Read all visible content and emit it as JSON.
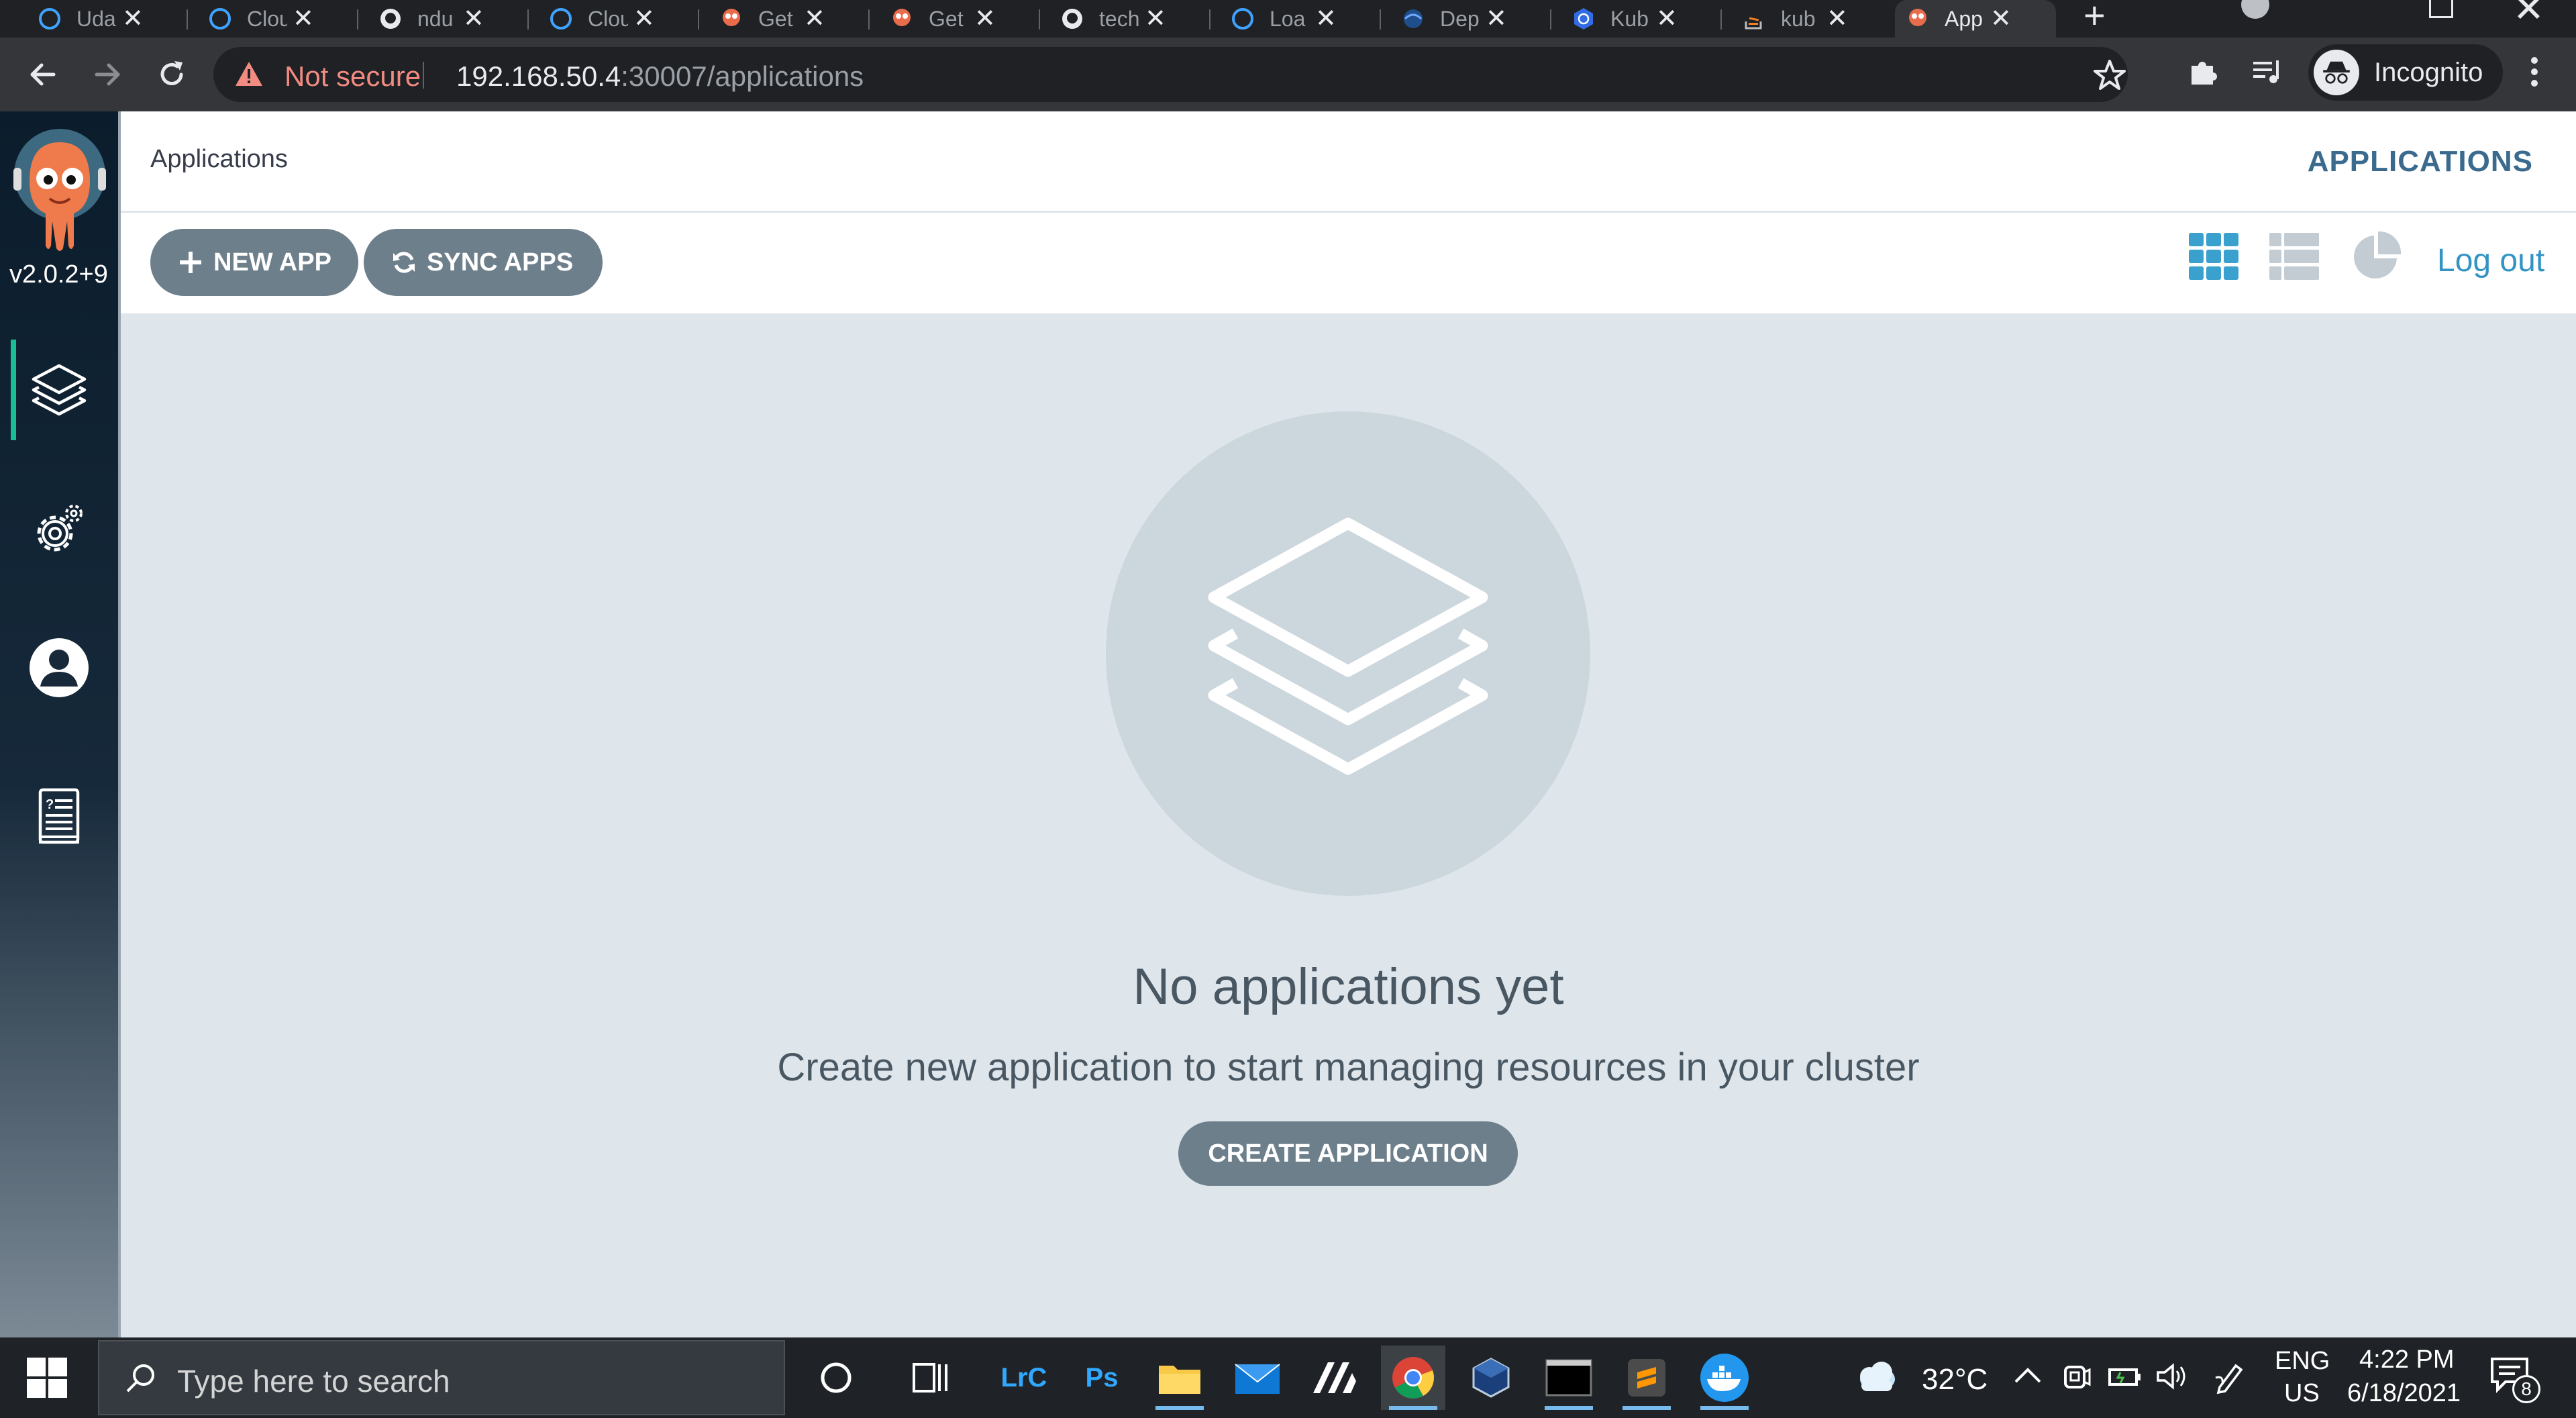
{
  "browser": {
    "tabs": [
      {
        "title": "Uda",
        "icon": "udacity-icon"
      },
      {
        "title": "Clou",
        "icon": "udacity-icon"
      },
      {
        "title": "ndu",
        "icon": "github-icon"
      },
      {
        "title": "Clou",
        "icon": "udacity-icon"
      },
      {
        "title": "Get",
        "icon": "argo-icon"
      },
      {
        "title": "Get",
        "icon": "argo-icon"
      },
      {
        "title": "tech",
        "icon": "github-icon"
      },
      {
        "title": "Loa",
        "icon": "udacity-icon"
      },
      {
        "title": "Dep",
        "icon": "globe-icon"
      },
      {
        "title": "Kub",
        "icon": "kubernetes-icon"
      },
      {
        "title": "kub",
        "icon": "stackoverflow-icon"
      },
      {
        "title": "App",
        "icon": "argo-icon",
        "active": true
      }
    ],
    "security_label": "Not secure",
    "url_host": "192.168.50.4",
    "url_path": ":30007/applications",
    "profile_label": "Incognito"
  },
  "sidebar": {
    "version": "v2.0.2+9",
    "items": [
      {
        "name": "applications",
        "icon": "layers-icon",
        "active": true
      },
      {
        "name": "settings",
        "icon": "gear-icon"
      },
      {
        "name": "user-info",
        "icon": "user-icon"
      },
      {
        "name": "documentation",
        "icon": "docs-icon"
      }
    ],
    "accent": "#18be94"
  },
  "header": {
    "title": "Applications",
    "top_link": "APPLICATIONS"
  },
  "toolbar": {
    "new_app_label": "NEW APP",
    "sync_apps_label": "SYNC APPS",
    "logout_label": "Log out",
    "views": [
      "tiles-view-icon",
      "list-view-icon",
      "summary-pie-icon"
    ]
  },
  "empty_state": {
    "title": "No applications yet",
    "subtitle": "Create new application to start managing resources in your cluster",
    "button_label": "CREATE APPLICATION"
  },
  "taskbar": {
    "search_placeholder": "Type here to search",
    "apps": [
      "cortana-icon",
      "task-view-icon",
      "lightroom-icon",
      "photoshop-icon",
      "file-explorer-icon",
      "mail-icon",
      "app-icon",
      "chrome-icon",
      "virtualbox-icon",
      "terminal-icon",
      "sublime-text-icon",
      "docker-icon"
    ],
    "lightroom_label": "LrC",
    "photoshop_label": "Ps",
    "temperature": "32°C",
    "language_line1": "ENG",
    "language_line2": "US",
    "time": "4:22 PM",
    "date": "6/18/2021",
    "notification_count": "8"
  },
  "colors": {
    "primary_button": "#6d7f8b",
    "link": "#3394c4",
    "background": "#dee6eb"
  }
}
